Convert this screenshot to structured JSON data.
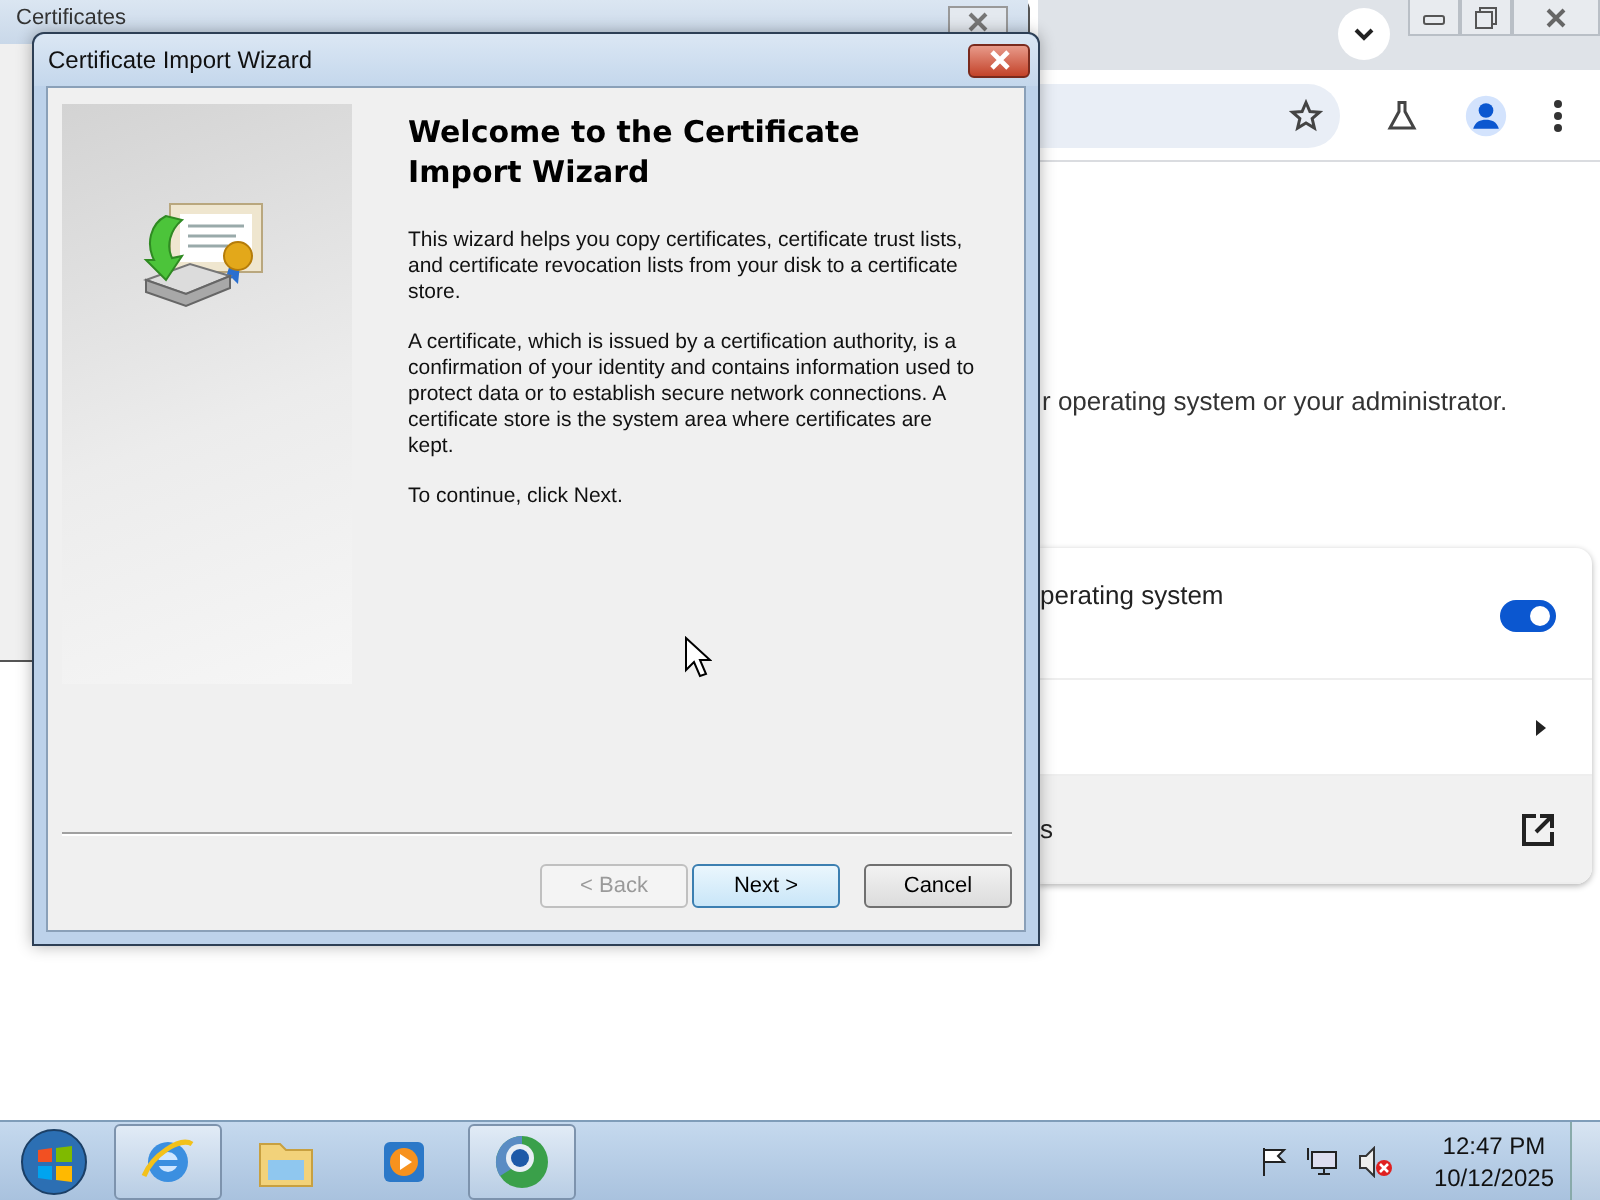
{
  "certificates_window": {
    "title": "Certificates"
  },
  "browser": {
    "page_text": "r operating system or your administrator.",
    "settings_rows": [
      {
        "kind": "toggle",
        "label": "perating system",
        "on": true,
        "hovered": false
      },
      {
        "kind": "submenu",
        "hovered": false
      },
      {
        "kind": "external",
        "label": "s",
        "hovered": true
      }
    ]
  },
  "wizard": {
    "title": "Certificate Import Wizard",
    "heading": "Welcome to the Certificate Import Wizard",
    "paragraphs": [
      "This wizard helps you copy certificates, certificate trust lists, and certificate revocation lists from your disk to a certificate store.",
      "A certificate, which is issued by a certification authority, is a confirmation of your identity and contains information used to protect data or to establish secure network connections. A certificate store is the system area where certificates are kept.",
      "To continue, click Next."
    ],
    "buttons": [
      {
        "label": "< Back",
        "disabled": true,
        "default": false
      },
      {
        "label": "Next >",
        "disabled": false,
        "default": true
      },
      {
        "label": "Cancel",
        "disabled": false,
        "default": false
      }
    ]
  },
  "taskbar": {
    "apps": [
      {
        "kind": "browser-e",
        "active": true
      },
      {
        "kind": "folder",
        "active": false
      },
      {
        "kind": "media",
        "active": false
      },
      {
        "kind": "globe",
        "active": true
      }
    ],
    "time": "12:47 PM",
    "date": "10/12/2025"
  }
}
